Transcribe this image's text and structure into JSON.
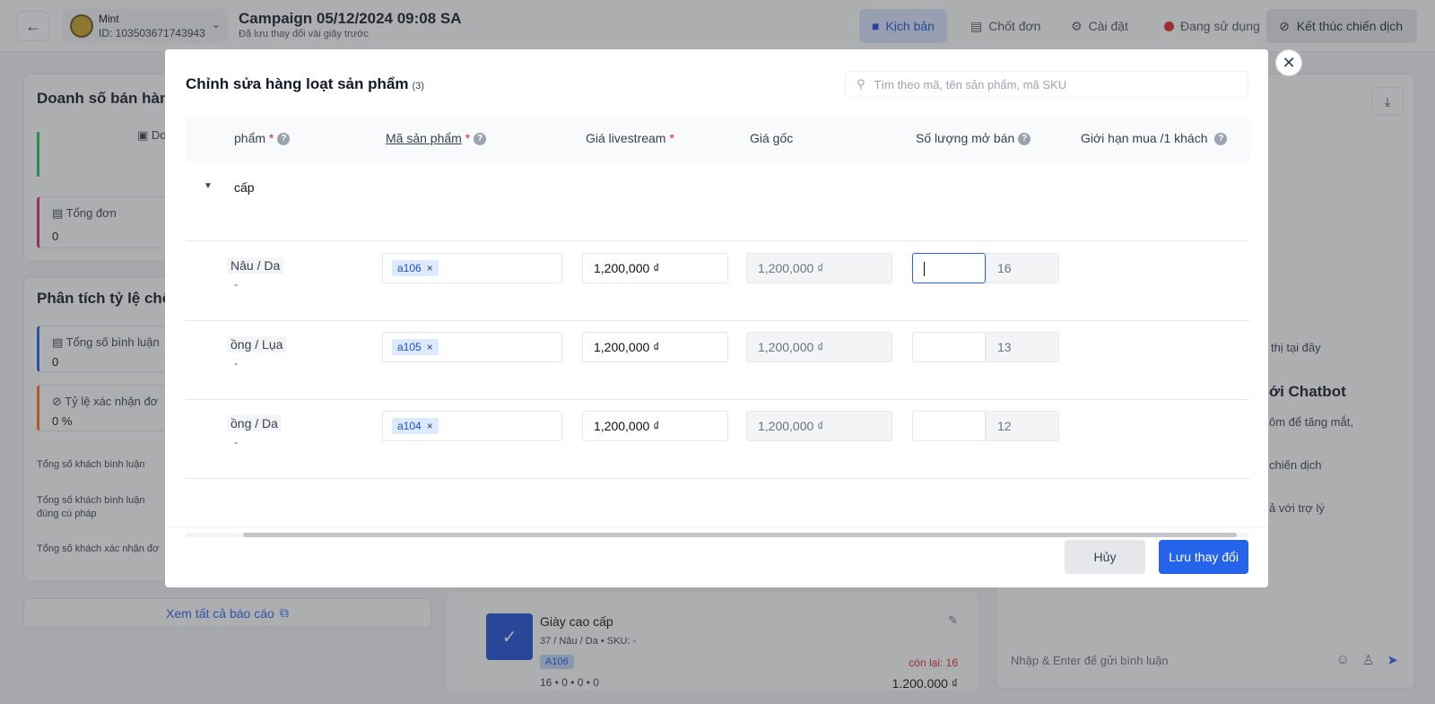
{
  "header": {
    "account_name": "Mint",
    "account_id": "ID: 103503671743943",
    "campaign_title": "Campaign 05/12/2024 09:08 SA",
    "campaign_subtitle": "Đã lưu thay đổi vài giây trước",
    "nav": {
      "script": "Kịch bản",
      "orders": "Chốt đơn",
      "settings": "Cài đặt",
      "status": "Đang sử dụng",
      "end_campaign": "Kết thúc chiến dịch"
    }
  },
  "left_panel": {
    "sales_title": "Doanh số bán hàn",
    "sales_sub": "Do",
    "total_orders_label": "Tổng đơn",
    "total_orders_value": "0",
    "analysis_title": "Phân tích tỷ lệ chố",
    "total_comments_label": "Tổng số bình luận",
    "total_comments_value": "0",
    "confirm_rate_label": "Tỷ lệ xác nhận đơ",
    "confirm_rate_value": "0 %",
    "commenters_label": "Tổng số khách bình luận",
    "valid_syntax_label_1": "Tổng số khách bình luận",
    "valid_syntax_label_2": "đúng cú pháp",
    "confirmed_label": "Tổng số khách xác nhận đơ",
    "view_reports": "Xem tất cả báo cáo"
  },
  "product_card": {
    "name": "Giày cao cấp",
    "meta": "37 / Nâu / Da • SKU: -",
    "tag": "A106",
    "stats": "16 • 0 • 0 • 0",
    "remain": "còn lại: 16",
    "price": "1.200.000 ₫"
  },
  "right_panel": {
    "hint": "thị tại đây",
    "chatbot_title": "ới Chatbot",
    "line1": "ôm để tăng mắt,",
    "line2": "chiến dịch",
    "line3": "ả với trợ lý",
    "chat_placeholder": "Nhập & Enter để gửi bình luận"
  },
  "modal": {
    "title": "Chỉnh sửa hàng loạt sản phẩm",
    "count": "(3)",
    "search_placeholder": "Tìm theo mã, tên sản phẩm, mã SKU",
    "columns": {
      "product": "phẩm",
      "sku": "Mã sản phẩm",
      "live_price": "Giá livestream",
      "original_price": "Giá gốc",
      "quantity": "Số lượng mở bán",
      "limit": "Giới hạn mua /1 khách"
    },
    "group_name": "cấp",
    "rows": [
      {
        "variant": "Nâu / Da",
        "variant_sub": "-",
        "sku": "a106",
        "live_price": "1,200,000 ₫",
        "original_price": "1,200,000 ₫",
        "quantity": "",
        "stock": "16"
      },
      {
        "variant": "ồng / Lụa",
        "variant_sub": "-",
        "sku": "a105",
        "live_price": "1,200,000 ₫",
        "original_price": "1,200,000 ₫",
        "quantity": "",
        "stock": "13"
      },
      {
        "variant": "ồng / Da",
        "variant_sub": "-",
        "sku": "a104",
        "live_price": "1,200,000 ₫",
        "original_price": "1,200,000 ₫",
        "quantity": "",
        "stock": "12"
      }
    ],
    "cancel": "Hủy",
    "save": "Lưu thay đổi"
  }
}
